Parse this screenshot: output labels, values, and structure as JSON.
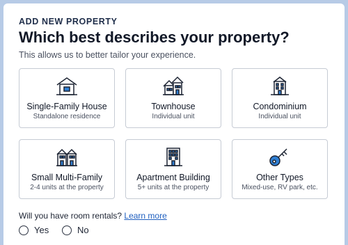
{
  "header": {
    "eyebrow": "ADD NEW PROPERTY",
    "title": "Which best describes your property?",
    "subtitle": "This allows us to better tailor your experience."
  },
  "property_types": [
    {
      "label": "Single-Family House",
      "sub": "Standalone residence",
      "icon": "house-icon"
    },
    {
      "label": "Townhouse",
      "sub": "Individual unit",
      "icon": "townhouse-icon"
    },
    {
      "label": "Condominium",
      "sub": "Individual unit",
      "icon": "condominium-icon"
    },
    {
      "label": "Small Multi-Family",
      "sub": "2-4 units at the property",
      "icon": "multi-family-icon"
    },
    {
      "label": "Apartment Building",
      "sub": "5+ units at the property",
      "icon": "apartment-building-icon"
    },
    {
      "label": "Other Types",
      "sub": "Mixed-use, RV park, etc.",
      "icon": "key-icon"
    }
  ],
  "room_rentals": {
    "question": "Will you have room rentals?",
    "link": "Learn more",
    "options": [
      "Yes",
      "No"
    ]
  },
  "colors": {
    "background": "#b7cbe6",
    "accent": "#2f7fd3",
    "link": "#1f5fbf",
    "card_border": "#c6cbd4"
  }
}
